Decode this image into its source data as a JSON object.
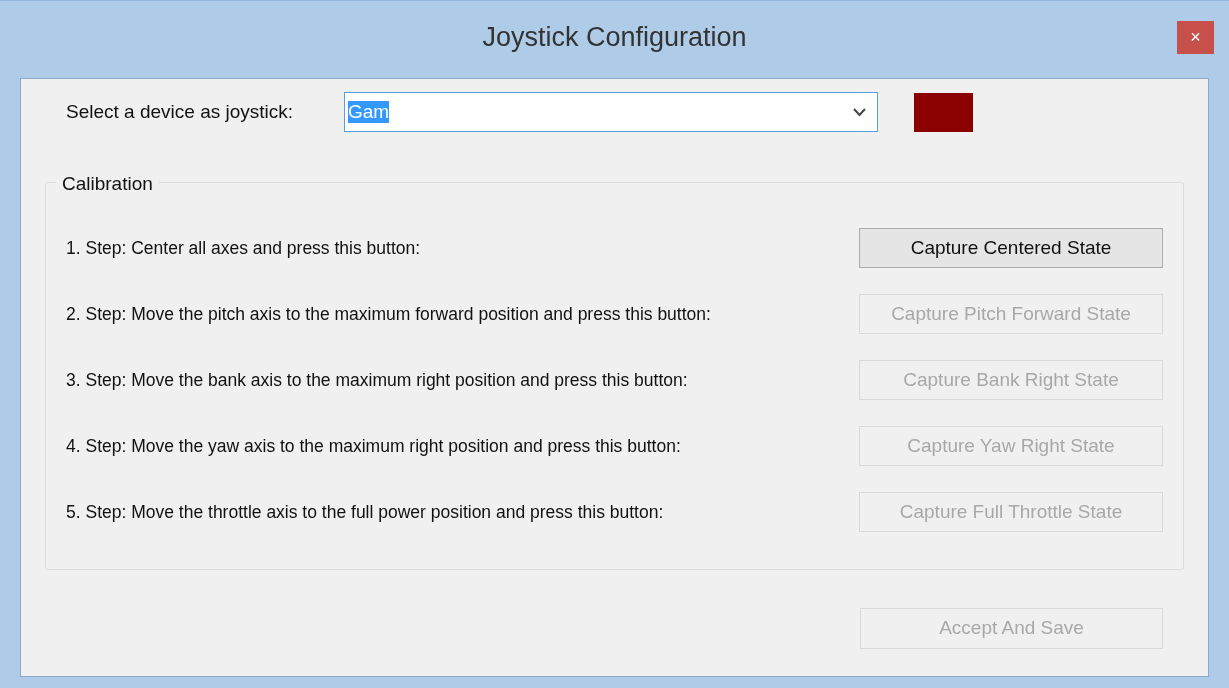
{
  "window": {
    "title": "Joystick Configuration",
    "close": "×"
  },
  "device": {
    "label": "Select a device as joystick:",
    "value": "Gam",
    "indicator": {
      "color": "#8b0000"
    }
  },
  "calibration": {
    "title": "Calibration",
    "steps": [
      {
        "text": "1. Step: Center all axes and press this button:",
        "button": "Capture Centered State",
        "disabled": false
      },
      {
        "text": "2. Step: Move the pitch axis to the maximum forward position and press this button:",
        "button": "Capture Pitch Forward State",
        "disabled": true
      },
      {
        "text": "3. Step: Move the bank axis to the maximum right position and press this button:",
        "button": "Capture Bank Right State",
        "disabled": true
      },
      {
        "text": "4. Step: Move the yaw axis to the maximum right position and press this button:",
        "button": "Capture Yaw Right State",
        "disabled": true
      },
      {
        "text": "5. Step: Move the throttle axis to the full power position and press this button:",
        "button": "Capture Full Throttle State",
        "disabled": true
      }
    ]
  },
  "footer": {
    "button": "Accept And Save",
    "disabled": true
  }
}
